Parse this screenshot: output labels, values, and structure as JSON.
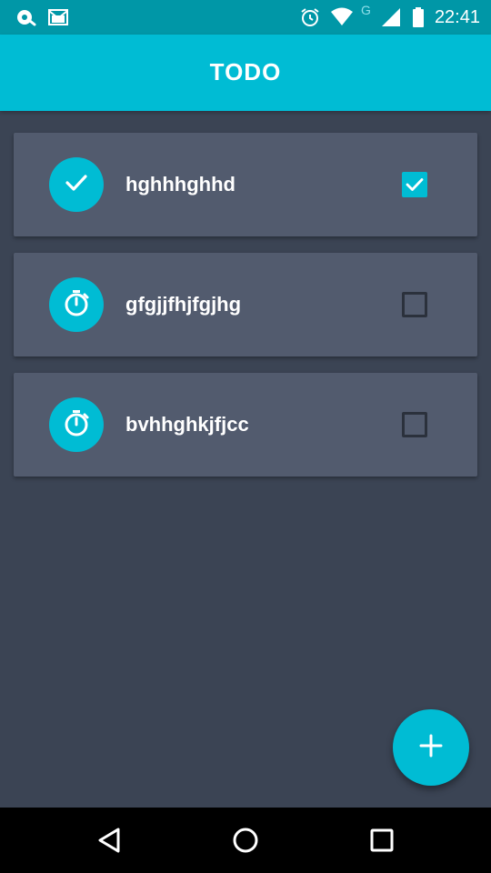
{
  "status_bar": {
    "time": "22:41",
    "network_letter": "G",
    "icons_left": [
      "sync-icon",
      "gmail-icon"
    ],
    "icons_right": [
      "alarm-icon",
      "wifi-icon",
      "signal-icon",
      "battery-icon"
    ]
  },
  "app_bar": {
    "title": "TODO"
  },
  "todos": [
    {
      "text": "hghhhghhd",
      "done": true,
      "icon": "check-icon"
    },
    {
      "text": "gfgjjfhjfgjhg",
      "done": false,
      "icon": "stopwatch-icon"
    },
    {
      "text": "bvhhghkjfjcc",
      "done": false,
      "icon": "stopwatch-icon"
    }
  ],
  "fab": {
    "icon": "plus-icon"
  },
  "nav_bar": {
    "buttons": [
      "back-icon",
      "home-icon",
      "recents-icon"
    ]
  },
  "colors": {
    "accent": "#00bcd4",
    "status_bar": "#0097a7",
    "background": "#3b4454",
    "card": "#525b6e"
  }
}
